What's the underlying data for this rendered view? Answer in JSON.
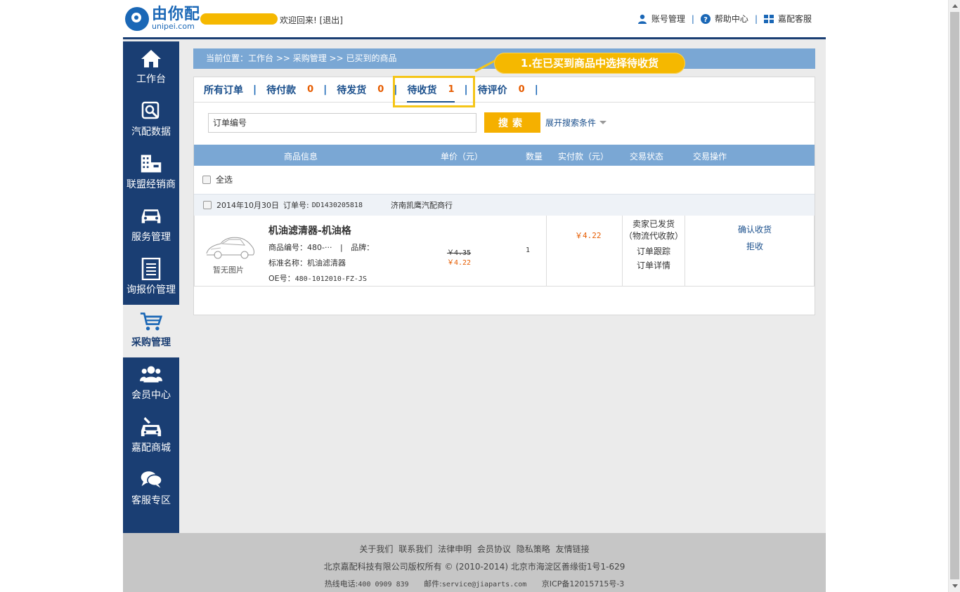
{
  "header": {
    "logo_cn": "由你配",
    "logo_en": "unipei.com",
    "welcome": "欢迎回来! [退出]",
    "links": [
      {
        "label": "账号管理",
        "icon": "user-icon"
      },
      {
        "label": "帮助中心",
        "icon": "help-icon"
      },
      {
        "label": "嘉配客服",
        "icon": "grid-icon"
      }
    ],
    "separator": "|"
  },
  "sidebar": {
    "items": [
      {
        "label": "工作台",
        "icon": "home-icon",
        "active": false
      },
      {
        "label": "汽配数据",
        "icon": "search-data-icon",
        "active": false
      },
      {
        "label": "联盟经销商",
        "icon": "building-icon",
        "active": false
      },
      {
        "label": "服务管理",
        "icon": "car-icon",
        "active": false
      },
      {
        "label": "询报价管理",
        "icon": "document-icon",
        "active": false
      },
      {
        "label": "采购管理",
        "icon": "cart-icon",
        "active": true
      },
      {
        "label": "会员中心",
        "icon": "members-icon",
        "active": false
      },
      {
        "label": "嘉配商城",
        "icon": "car-shop-icon",
        "active": false
      },
      {
        "label": "客服专区",
        "icon": "chat-icon",
        "active": false
      }
    ]
  },
  "breadcrumb": "当前位置：工作台 >> 采购管理 >> 已买到的商品",
  "callout": "1.在已买到商品中选择待收货",
  "tabs": [
    {
      "label": "所有订单",
      "count": ""
    },
    {
      "label": "待付款",
      "count": "0"
    },
    {
      "label": "待发货",
      "count": "0"
    },
    {
      "label": "待收货",
      "count": "1",
      "active": true
    },
    {
      "label": "待评价",
      "count": "0"
    }
  ],
  "tab_separator": "|",
  "search": {
    "placeholder": "订单编号",
    "value": "订单编号",
    "button_label": "搜索",
    "expand_label": "展开搜索条件"
  },
  "table": {
    "headers": [
      "商品信息",
      "单价（元）",
      "数量",
      "实付款（元）",
      "交易状态",
      "交易操作"
    ],
    "select_all": "全选"
  },
  "order": {
    "date": "2014年10月30日",
    "order_no_label": "订单号:",
    "order_no": "DD1430205818",
    "seller": "济南凯鹰汽配商行",
    "no_image": "暂无图片",
    "product_name": "机油滤清器-机油格",
    "product_code": "商品编号：480-···",
    "brand_sep": "|",
    "brand": "品牌：",
    "std_name": "标准名称：机油滤清器",
    "oe_label": "OE号：",
    "oe_no": "480-1012010-FZ-JS",
    "old_price": "￥4.35",
    "new_price": "￥4.22",
    "quantity": "1",
    "paid": "￥4.22",
    "status_lines": [
      "卖家已发货",
      "（物流代收款）"
    ],
    "status_links": [
      "订单跟踪",
      "订单详情"
    ],
    "actions": [
      "确认收货",
      "拒收"
    ]
  },
  "footer": {
    "links": [
      "关于我们",
      "联系我们",
      "法律申明",
      "会员协议",
      "隐私策略",
      "友情链接"
    ],
    "copyright": "北京嘉配科技有限公司版权所有 © (2010-2014) 北京市海淀区善缘街1号1-629",
    "hotline_label": "热线电话:",
    "hotline": "400 0909 839",
    "email_label": "邮件:",
    "email": "service@jiaparts.com",
    "icp": "京ICP备12015715号-3"
  },
  "colors": {
    "nav_bg": "#1a3e73",
    "accent_blue": "#7aa7d4",
    "brand_blue": "#1a67b6",
    "orange": "#f5b000",
    "price_orange": "#e65c00",
    "highlight_yellow": "#f5c518"
  }
}
